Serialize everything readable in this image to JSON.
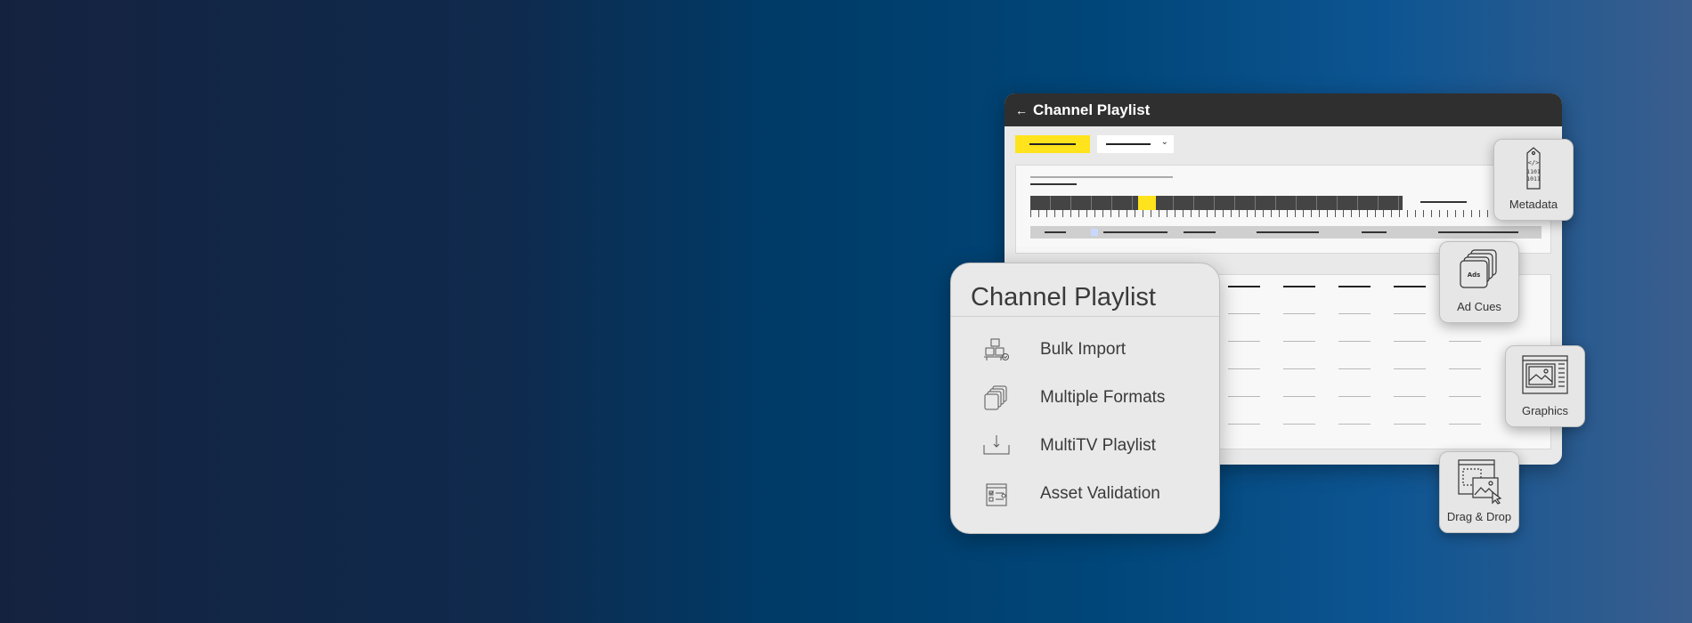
{
  "app_window": {
    "title": "Channel Playlist",
    "back_icon": "arrow-left-icon",
    "accent_color": "#ffe31c",
    "titlebar_color": "#2f2f2f"
  },
  "feature_card": {
    "title": "Channel Playlist",
    "features": [
      {
        "label": "Bulk Import",
        "icon": "boxes-icon"
      },
      {
        "label": "Multiple Formats",
        "icon": "stacked-layers-icon"
      },
      {
        "label": "MultiTV Playlist",
        "icon": "download-tray-icon"
      },
      {
        "label": "Asset Validation",
        "icon": "checklist-document-icon"
      }
    ]
  },
  "badges": {
    "metadata": {
      "label": "Metadata",
      "icon": "code-tag-icon"
    },
    "ad_cues": {
      "label": "Ad Cues",
      "icon": "ads-stack-icon",
      "icon_text": "Ads"
    },
    "graphics": {
      "label": "Graphics",
      "icon": "image-window-icon"
    },
    "drag_drop": {
      "label": "Drag & Drop",
      "icon": "drag-image-cursor-icon"
    }
  }
}
